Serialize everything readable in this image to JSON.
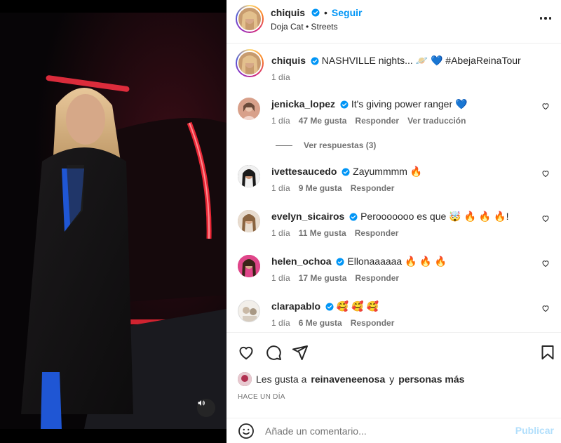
{
  "header": {
    "username": "chiquis",
    "separator": "•",
    "follow_label": "Seguir",
    "music": "Doja Cat • Streets",
    "more_icon": "more-horizontal-icon"
  },
  "caption": {
    "username": "chiquis",
    "text": "NASHVILLE nights... 🪐 💙 #AbejaReinaTour",
    "time": "1 día"
  },
  "comments": [
    {
      "username": "jenicka_lopez",
      "text": "It's giving power ranger 💙",
      "time": "1 día",
      "likes": "47 Me gusta",
      "reply": "Responder",
      "translate": "Ver traducción",
      "avatar_color": "#d8a08a"
    },
    {
      "username": "ivettesaucedo",
      "text": "Zayummmm 🔥",
      "time": "1 día",
      "likes": "9 Me gusta",
      "reply": "Responder",
      "avatar_color": "#2a2a2a"
    },
    {
      "username": "evelyn_sicairos",
      "text": "Perooooooo es que 🤯 🔥 🔥 🔥!",
      "time": "1 día",
      "likes": "11 Me gusta",
      "reply": "Responder",
      "avatar_color": "#b08a68"
    },
    {
      "username": "helen_ochoa",
      "text": "Ellonaaaaaa 🔥 🔥 🔥",
      "time": "1 día",
      "likes": "17 Me gusta",
      "reply": "Responder",
      "avatar_color": "#c0306a"
    },
    {
      "username": "clarapablo",
      "text": "🥰 🥰 🥰",
      "time": "1 día",
      "likes": "6 Me gusta",
      "reply": "Responder",
      "avatar_color": "#d9d4cf"
    }
  ],
  "view_replies": "Ver respuestas (3)",
  "actions": {
    "like_icon": "heart-icon",
    "comment_icon": "comment-icon",
    "share_icon": "share-icon",
    "save_icon": "bookmark-icon"
  },
  "likes_summary": {
    "prefix": "Les gusta a",
    "user": "reinaveneenosa",
    "middle": "y",
    "suffix": "personas más"
  },
  "time_ago": "HACE UN DÍA",
  "add_comment": {
    "placeholder": "Añade un comentario...",
    "publish_label": "Publicar"
  },
  "colors": {
    "accent": "#0095f6",
    "verified": "#0095f6",
    "publish_disabled": "#b2dffc"
  }
}
